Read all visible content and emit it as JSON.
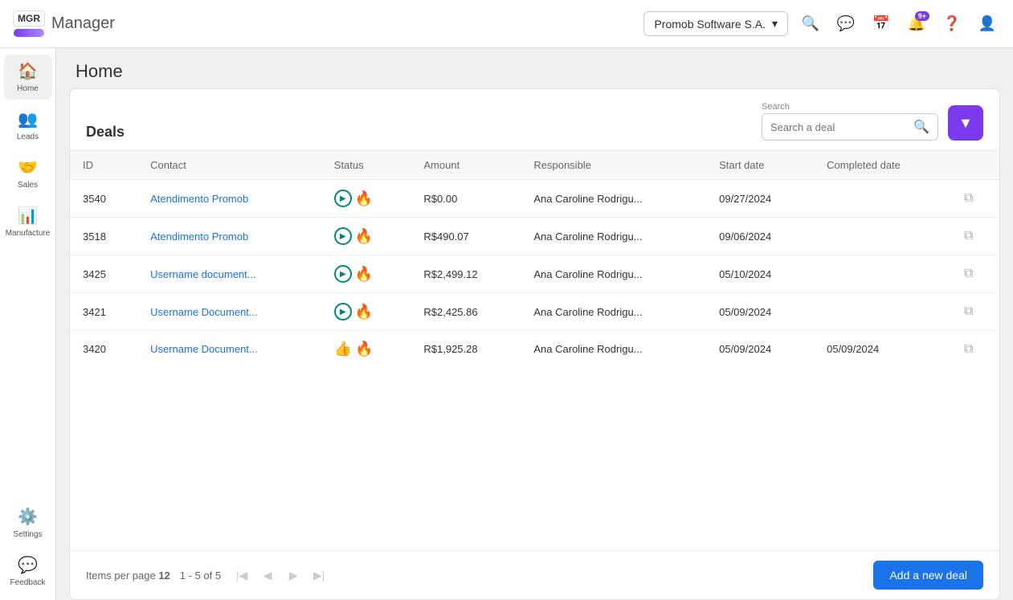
{
  "navbar": {
    "logo_mgr": "MGR",
    "logo_manager": "Manager",
    "company": "Promob Software S.A.",
    "notification_badge": "9+"
  },
  "sidebar": {
    "items": [
      {
        "id": "home",
        "label": "Home",
        "icon": "🏠",
        "active": true
      },
      {
        "id": "leads",
        "label": "Leads",
        "icon": "👥",
        "active": false
      },
      {
        "id": "sales",
        "label": "Sales",
        "icon": "🤝",
        "active": false
      },
      {
        "id": "manufacture",
        "label": "Manufacture",
        "icon": "📊",
        "active": false
      },
      {
        "id": "settings",
        "label": "Settings",
        "icon": "⚙️",
        "active": false
      },
      {
        "id": "feedback",
        "label": "Feedback",
        "icon": "💬",
        "active": false
      }
    ]
  },
  "page": {
    "title": "Home"
  },
  "deals": {
    "title": "Deals",
    "search_label": "Search",
    "search_placeholder": "Search a deal",
    "filter_label": "Filter",
    "add_button": "Add a new deal",
    "columns": [
      "ID",
      "Contact",
      "Status",
      "Amount",
      "Responsible",
      "Start date",
      "Completed date"
    ],
    "rows": [
      {
        "id": "3540",
        "contact": "Atendimento Promob",
        "status": "play-fire",
        "amount": "R$0.00",
        "responsible": "Ana Caroline Rodrigu...",
        "start_date": "09/27/2024",
        "completed_date": ""
      },
      {
        "id": "3518",
        "contact": "Atendimento Promob",
        "status": "play-fire",
        "amount": "R$490.07",
        "responsible": "Ana Caroline Rodrigu...",
        "start_date": "09/06/2024",
        "completed_date": ""
      },
      {
        "id": "3425",
        "contact": "Username document...",
        "status": "play-fire",
        "amount": "R$2,499.12",
        "responsible": "Ana Caroline Rodrigu...",
        "start_date": "05/10/2024",
        "completed_date": ""
      },
      {
        "id": "3421",
        "contact": "Username Document...",
        "status": "play-fire",
        "amount": "R$2,425.86",
        "responsible": "Ana Caroline Rodrigu...",
        "start_date": "05/09/2024",
        "completed_date": ""
      },
      {
        "id": "3420",
        "contact": "Username Document...",
        "status": "thumb-fire",
        "amount": "R$1,925.28",
        "responsible": "Ana Caroline Rodrigu...",
        "start_date": "05/09/2024",
        "completed_date": "05/09/2024"
      }
    ],
    "pagination": {
      "items_per_page_label": "Items per page",
      "items_per_page": "12",
      "range": "1 - 5 of 5"
    }
  }
}
